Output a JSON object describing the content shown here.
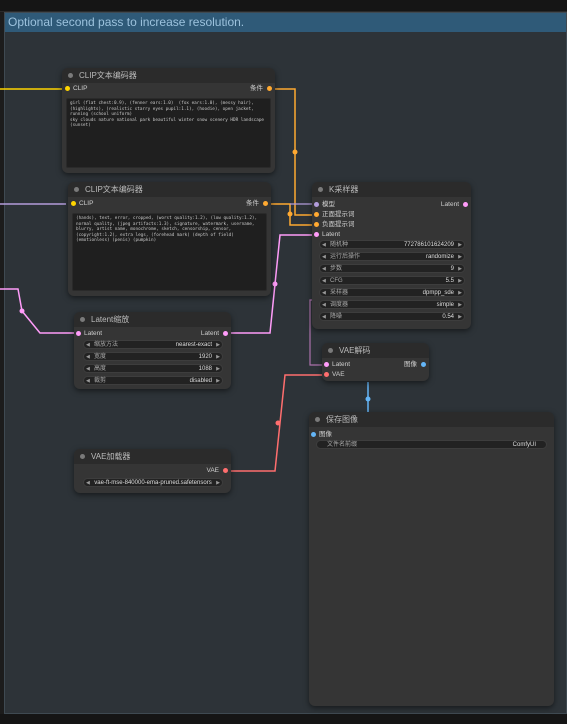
{
  "group_title": "Optional second pass to increase resolution.",
  "colors": {
    "clip": "#ffd500",
    "conditioning": "#ffa931",
    "latent": "#ff9cf9",
    "model": "#b39ddb",
    "vae": "#ff6e6e",
    "image": "#64b5f6"
  },
  "clip_top": {
    "title": "CLIP文本编码器",
    "input_clip": "CLIP",
    "output": "条件",
    "text": "girl (flat chest:0.9), (fenner ears:1.0)  (fox ears:1.0), (messy hair), (highlights), (realistic starry eyes pupil:1.1), (hoodie), open jacket, running (school uniform)\nsky clouds nature national park beautiful winter snow scenery HDR landscape\n(sunset)"
  },
  "clip_bottom": {
    "title": "CLIP文本编码器",
    "input_clip": "CLIP",
    "output": "条件",
    "text": "(hands), text, error, cropped, (worst quality:1.2), (low quality:1.2), normal quality, (jpeg artifacts:1.3), signature, watermark, username, blurry, artist name, monochrome, sketch, censorship, censor, (copyright:1.2), extra legs, (forehead mark) (depth of field) (emotionless) (penis) (pumpkin)"
  },
  "ksampler": {
    "title": "K采样器",
    "inputs": [
      "模型",
      "正面提示词",
      "负面提示词",
      "Latent"
    ],
    "output": "Latent",
    "widgets": [
      {
        "label": "随机种",
        "value": "772786101624209"
      },
      {
        "label": "运行后操作",
        "value": "randomize"
      },
      {
        "label": "步数",
        "value": "9"
      },
      {
        "label": "CFG",
        "value": "5.5"
      },
      {
        "label": "采样器",
        "value": "dpmpp_sde"
      },
      {
        "label": "调度器",
        "value": "simple"
      },
      {
        "label": "降噪",
        "value": "0.54"
      }
    ]
  },
  "latent_scale": {
    "title": "Latent缩放",
    "input": "Latent",
    "output": "Latent",
    "widgets": [
      {
        "label": "缩放方法",
        "value": "nearest-exact"
      },
      {
        "label": "宽度",
        "value": "1920"
      },
      {
        "label": "高度",
        "value": "1088"
      },
      {
        "label": "裁剪",
        "value": "disabled"
      }
    ]
  },
  "vae_decode": {
    "title": "VAE解码",
    "inputs": [
      "Latent",
      "VAE"
    ],
    "output": "图像"
  },
  "vae_loader": {
    "title": "VAE加载器",
    "output": "VAE",
    "value": "vae-ft-mse-840000-ema-pruned.safetensors"
  },
  "save_image": {
    "title": "保存图像",
    "input": "图像",
    "widget_label": "文件名前缀",
    "widget_value": "ComfyUI"
  }
}
